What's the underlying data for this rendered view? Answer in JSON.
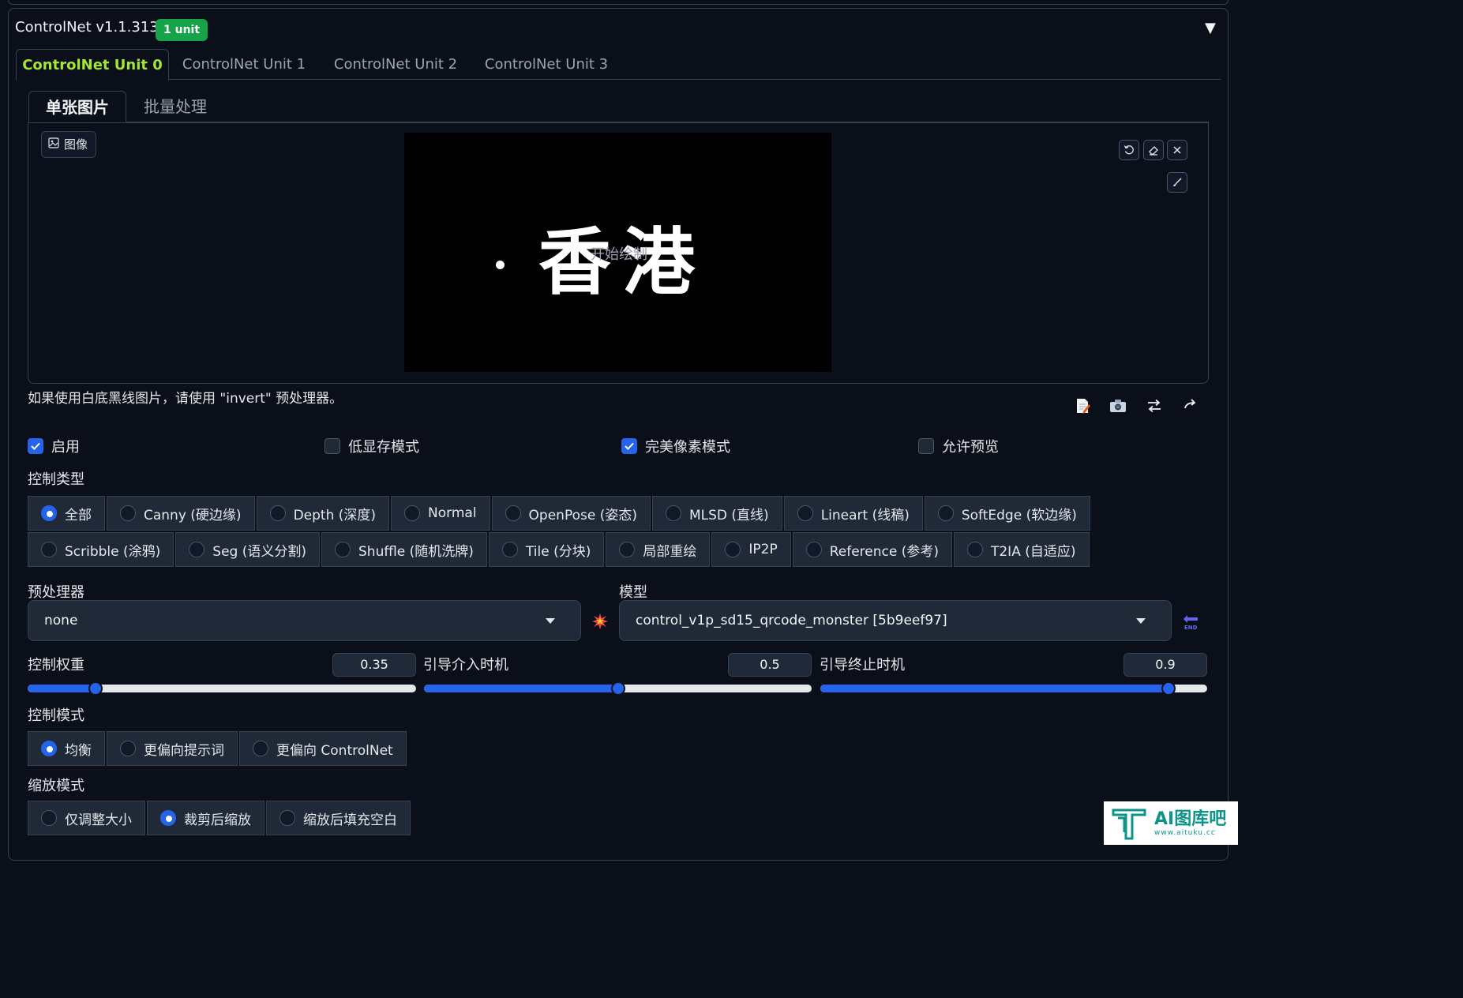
{
  "header": {
    "title": "ControlNet v1.1.313",
    "badge": "1 unit",
    "collapse_icon": "triangle-down-icon"
  },
  "unit_tabs": [
    "ControlNet Unit 0",
    "ControlNet Unit 1",
    "ControlNet Unit 2",
    "ControlNet Unit 3"
  ],
  "image_tabs": [
    "单张图片",
    "批量处理"
  ],
  "image_panel": {
    "label": "图像",
    "canvas_text": "香港",
    "overlay_text": "开始绘制"
  },
  "hint": "如果使用白底黑线图片，请使用 \"invert\" 预处理器。",
  "options": [
    {
      "label": "启用",
      "checked": true
    },
    {
      "label": "低显存模式",
      "checked": false
    },
    {
      "label": "完美像素模式",
      "checked": true
    },
    {
      "label": "允许预览",
      "checked": false
    }
  ],
  "control_type": {
    "label": "控制类型",
    "items": [
      "全部",
      "Canny (硬边缘)",
      "Depth (深度)",
      "Normal",
      "OpenPose (姿态)",
      "MLSD (直线)",
      "Lineart (线稿)",
      "SoftEdge (软边缘)",
      "Scribble (涂鸦)",
      "Seg (语义分割)",
      "Shuffle (随机洗牌)",
      "Tile (分块)",
      "局部重绘",
      "IP2P",
      "Reference (参考)",
      "T2IA (自适应)"
    ],
    "selected": "全部"
  },
  "preprocessor": {
    "label": "预处理器",
    "value": "none"
  },
  "model": {
    "label": "模型",
    "value": "control_v1p_sd15_qrcode_monster [5b9eef97]"
  },
  "sliders": [
    {
      "label": "控制权重",
      "value": "0.35",
      "min": 0,
      "max": 2,
      "num": 0.35
    },
    {
      "label": "引导介入时机",
      "value": "0.5",
      "min": 0,
      "max": 1,
      "num": 0.5
    },
    {
      "label": "引导终止时机",
      "value": "0.9",
      "min": 0,
      "max": 1,
      "num": 0.9
    }
  ],
  "control_mode": {
    "label": "控制模式",
    "items": [
      "均衡",
      "更偏向提示词",
      "更偏向 ControlNet"
    ],
    "selected": "均衡"
  },
  "resize_mode": {
    "label": "缩放模式",
    "items": [
      "仅调整大小",
      "裁剪后缩放",
      "缩放后填充空白"
    ],
    "selected": "裁剪后缩放"
  },
  "watermark": {
    "name": "AI图库吧",
    "url": "www.aituku.cc"
  },
  "colors": {
    "accent": "#2563eb",
    "active_tab": "#a3e635",
    "badge": "#16a34a",
    "background": "#0b0f19"
  }
}
